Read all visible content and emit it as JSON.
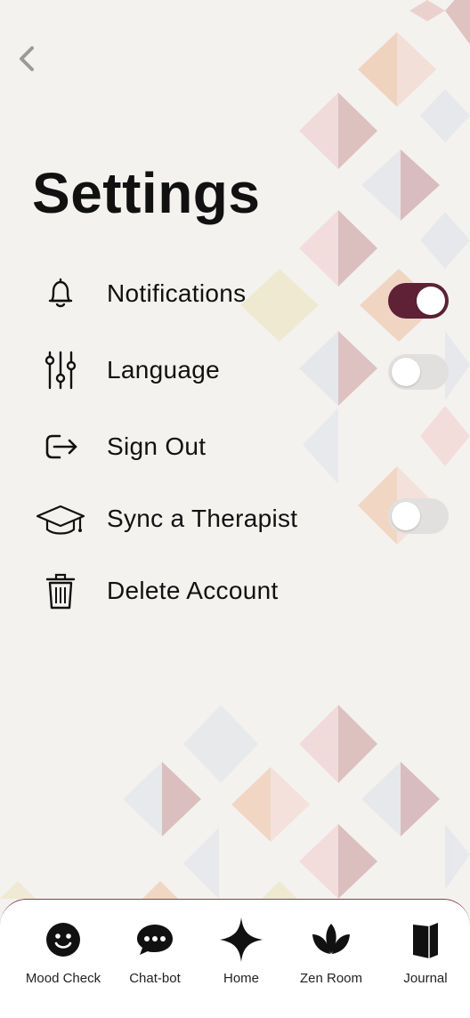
{
  "title": "Settings",
  "back": {
    "icon": "chevron-left-icon"
  },
  "settings": [
    {
      "id": "notifications",
      "label": "Notifications",
      "icon": "bell-icon",
      "toggle": true,
      "on": true
    },
    {
      "id": "language",
      "label": "Language",
      "icon": "sliders-icon",
      "toggle": true,
      "on": false
    },
    {
      "id": "sign-out",
      "label": "Sign Out",
      "icon": "sign-out-icon",
      "toggle": false
    },
    {
      "id": "sync-therapist",
      "label": "Sync a Therapist",
      "icon": "graduation-cap-icon",
      "toggle": true,
      "on": false
    },
    {
      "id": "delete-account",
      "label": "Delete Account",
      "icon": "trash-icon",
      "toggle": false
    }
  ],
  "nav": [
    {
      "label": "Mood Check",
      "icon": "smiley-icon"
    },
    {
      "label": "Chat-bot",
      "icon": "chat-bubble-icon"
    },
    {
      "label": "Home",
      "icon": "sparkle-icon"
    },
    {
      "label": "Zen Room",
      "icon": "lotus-icon"
    },
    {
      "label": "Journal",
      "icon": "journal-icon"
    }
  ],
  "colors": {
    "toggle_on": "#5e2136",
    "toggle_off": "#e2e0de",
    "background": "#f4f2ef",
    "nav_border": "#8a3b4c"
  }
}
